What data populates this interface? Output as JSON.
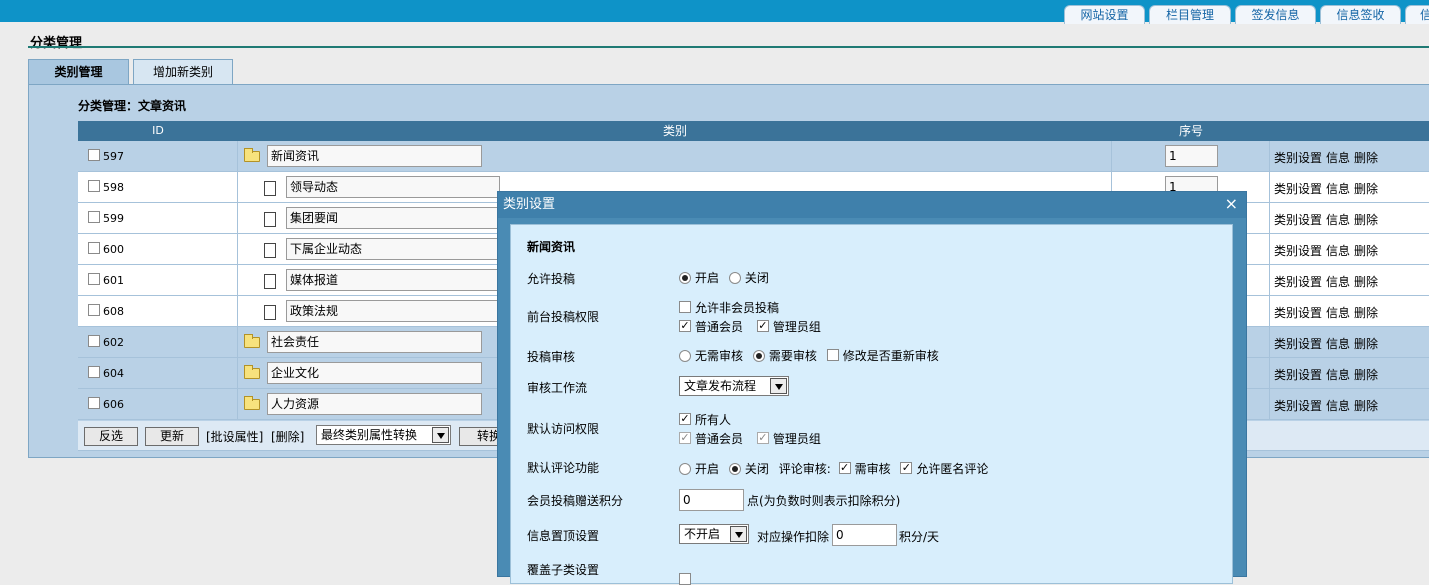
{
  "top_tabs": [
    "网站设置",
    "栏目管理",
    "签发信息",
    "信息签收",
    "信"
  ],
  "page_title": "分类管理",
  "tabs": {
    "active": "类别管理",
    "add": "增加新类别"
  },
  "panel_subtitle": "分类管理：文章资讯",
  "grid": {
    "headers": {
      "id": "ID",
      "category": "类别",
      "order": "序号"
    },
    "rows": [
      {
        "id": "597",
        "name": "新闻资讯",
        "order": "1",
        "level": "parent"
      },
      {
        "id": "598",
        "name": "领导动态",
        "order": "1",
        "level": "child"
      },
      {
        "id": "599",
        "name": "集团要闻",
        "order": "",
        "level": "child"
      },
      {
        "id": "600",
        "name": "下属企业动态",
        "order": "",
        "level": "child"
      },
      {
        "id": "601",
        "name": "媒体报道",
        "order": "",
        "level": "child"
      },
      {
        "id": "608",
        "name": "政策法规",
        "order": "",
        "level": "child"
      },
      {
        "id": "602",
        "name": "社会责任",
        "order": "",
        "level": "parent"
      },
      {
        "id": "604",
        "name": "企业文化",
        "order": "",
        "level": "parent"
      },
      {
        "id": "606",
        "name": "人力资源",
        "order": "",
        "level": "parent"
      }
    ],
    "actions": {
      "settings": "类别设置",
      "info": "信息",
      "delete": "删除"
    }
  },
  "footer": {
    "invert_button": "反选",
    "update_button": "更新",
    "batch_set": "[批设属性]",
    "delete_link": "[删除]",
    "convert_select": "最终类别属性转换",
    "convert_button": "转换"
  },
  "modal": {
    "title": "类别设置",
    "close": "×",
    "heading": "新闻资讯",
    "allow_submit": {
      "label": "允许投稿",
      "on": "开启",
      "off": "关闭"
    },
    "front_permission": {
      "label": "前台投稿权限",
      "non_member": "允许非会员投稿",
      "normal_member": "普通会员",
      "admin_group": "管理员组"
    },
    "review": {
      "label": "投稿审核",
      "no_review": "无需审核",
      "need_review": "需要审核",
      "re_review": "修改是否重新审核"
    },
    "workflow": {
      "label": "审核工作流",
      "value": "文章发布流程"
    },
    "access": {
      "label": "默认访问权限",
      "everyone": "所有人",
      "normal_member": "普通会员",
      "admin_group": "管理员组"
    },
    "comment": {
      "label": "默认评论功能",
      "on": "开启",
      "off": "关闭",
      "review_label": "评论审核:",
      "need_review": "需审核",
      "anonymous": "允许匿名评论"
    },
    "points": {
      "label": "会员投稿赠送积分",
      "value": "0",
      "note": "点(为负数时则表示扣除积分)"
    },
    "top": {
      "label": "信息置顶设置",
      "value": "不开启",
      "deduct_label": "对应操作扣除",
      "deduct_value": "0",
      "unit": "积分/天"
    },
    "override": {
      "label": "覆盖子类设置"
    }
  }
}
